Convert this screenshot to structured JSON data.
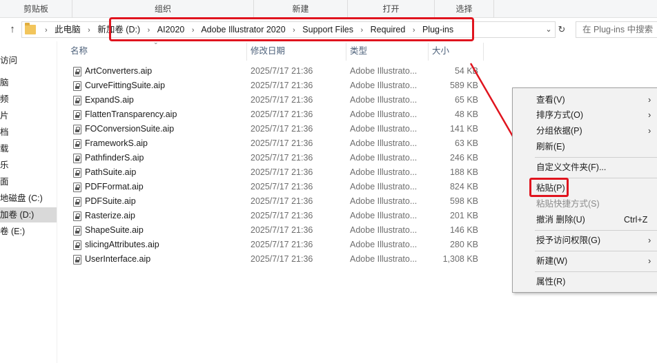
{
  "ribbon": {
    "groups": [
      {
        "label": "剪贴板"
      },
      {
        "label": "组织"
      },
      {
        "label": "新建"
      },
      {
        "label": "打开"
      },
      {
        "label": "选择"
      }
    ]
  },
  "address": {
    "crumbs": [
      "此电脑",
      "新加卷 (D:)",
      "AI2020",
      "Adobe Illustrator 2020",
      "Support Files",
      "Required",
      "Plug-ins"
    ],
    "search_placeholder": "在 Plug-ins 中搜索"
  },
  "nav_pane": {
    "items": [
      {
        "label": "访问"
      },
      {
        "label": "脑"
      },
      {
        "label": "频"
      },
      {
        "label": "片"
      },
      {
        "label": "档"
      },
      {
        "label": "载"
      },
      {
        "label": "乐"
      },
      {
        "label": "面"
      },
      {
        "label": "地磁盘 (C:)"
      },
      {
        "label": "加卷 (D:)",
        "selected": true
      },
      {
        "label": "卷 (E:)"
      }
    ]
  },
  "columns": {
    "name": "名称",
    "date": "修改日期",
    "type": "类型",
    "size": "大小"
  },
  "files": [
    {
      "name": "ArtConverters.aip",
      "date": "2025/7/17 21:36",
      "type": "Adobe Illustrato...",
      "size": "54 KB"
    },
    {
      "name": "CurveFittingSuite.aip",
      "date": "2025/7/17 21:36",
      "type": "Adobe Illustrato...",
      "size": "589 KB"
    },
    {
      "name": "ExpandS.aip",
      "date": "2025/7/17 21:36",
      "type": "Adobe Illustrato...",
      "size": "65 KB"
    },
    {
      "name": "FlattenTransparency.aip",
      "date": "2025/7/17 21:36",
      "type": "Adobe Illustrato...",
      "size": "48 KB"
    },
    {
      "name": "FOConversionSuite.aip",
      "date": "2025/7/17 21:36",
      "type": "Adobe Illustrato...",
      "size": "141 KB"
    },
    {
      "name": "FrameworkS.aip",
      "date": "2025/7/17 21:36",
      "type": "Adobe Illustrato...",
      "size": "63 KB"
    },
    {
      "name": "PathfinderS.aip",
      "date": "2025/7/17 21:36",
      "type": "Adobe Illustrato...",
      "size": "246 KB"
    },
    {
      "name": "PathSuite.aip",
      "date": "2025/7/17 21:36",
      "type": "Adobe Illustrato...",
      "size": "188 KB"
    },
    {
      "name": "PDFFormat.aip",
      "date": "2025/7/17 21:36",
      "type": "Adobe Illustrato...",
      "size": "824 KB"
    },
    {
      "name": "PDFSuite.aip",
      "date": "2025/7/17 21:36",
      "type": "Adobe Illustrato...",
      "size": "598 KB"
    },
    {
      "name": "Rasterize.aip",
      "date": "2025/7/17 21:36",
      "type": "Adobe Illustrato...",
      "size": "201 KB"
    },
    {
      "name": "ShapeSuite.aip",
      "date": "2025/7/17 21:36",
      "type": "Adobe Illustrato...",
      "size": "146 KB"
    },
    {
      "name": "slicingAttributes.aip",
      "date": "2025/7/17 21:36",
      "type": "Adobe Illustrato...",
      "size": "280 KB"
    },
    {
      "name": "UserInterface.aip",
      "date": "2025/7/17 21:36",
      "type": "Adobe Illustrato...",
      "size": "1,308 KB"
    }
  ],
  "context_menu": {
    "view": "查看(V)",
    "sort": "排序方式(O)",
    "group": "分组依据(P)",
    "refresh": "刷新(E)",
    "customize": "自定义文件夹(F)...",
    "paste": "粘贴(P)",
    "paste_shortcut": "粘贴快捷方式(S)",
    "undo": "撤消 删除(U)",
    "undo_shortcut": "Ctrl+Z",
    "grant_access": "授予访问权限(G)",
    "new": "新建(W)",
    "properties": "属性(R)"
  },
  "colors": {
    "highlight": "#e0141e",
    "header_text": "#4c607a",
    "folder": "#f2c55c"
  }
}
